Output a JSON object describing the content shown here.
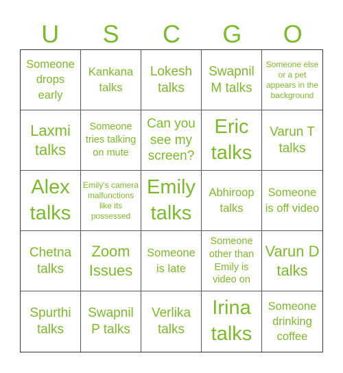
{
  "header": {
    "letters": [
      "U",
      "S",
      "C",
      "G",
      "O"
    ]
  },
  "colors": {
    "accent": "#7dba2b",
    "grid_line": "#333333",
    "background": "#ffffff"
  },
  "cells": [
    {
      "text": "Someone drops early"
    },
    {
      "text": "Kankana talks"
    },
    {
      "text": "Lokesh talks"
    },
    {
      "text": "Swapnil M talks"
    },
    {
      "text": "Someone else or a pet appears in the background"
    },
    {
      "text": "Laxmi talks"
    },
    {
      "text": "Someone tries talking on mute"
    },
    {
      "text": "Can you see my screen?"
    },
    {
      "text": "Eric talks"
    },
    {
      "text": "Varun T talks"
    },
    {
      "text": "Alex talks"
    },
    {
      "text": "Emily's camera malfunctions like its possessed"
    },
    {
      "text": "Emily talks"
    },
    {
      "text": "Abhiroop talks"
    },
    {
      "text": "Someone is off video"
    },
    {
      "text": "Chetna talks"
    },
    {
      "text": "Zoom Issues"
    },
    {
      "text": "Someone is late"
    },
    {
      "text": "Someone other than Emily is video on"
    },
    {
      "text": "Varun D talks"
    },
    {
      "text": "Spurthi talks"
    },
    {
      "text": "Swapnil P talks"
    },
    {
      "text": "Verlika talks"
    },
    {
      "text": "Irina talks"
    },
    {
      "text": "Someone drinking coffee"
    }
  ]
}
